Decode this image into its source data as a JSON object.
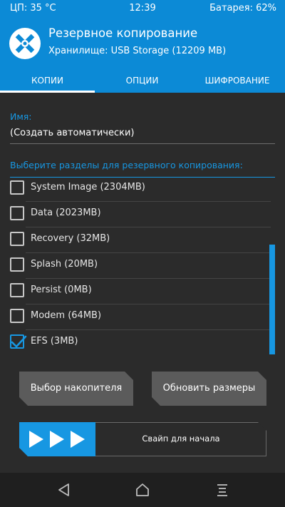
{
  "status": {
    "cpu": "ЦП: 35 °C",
    "time": "12:39",
    "battery": "Батарея: 62%"
  },
  "header": {
    "title": "Резервное копирование",
    "subtitle": "Хранилище: USB Storage (12209 MB)",
    "logo_icon": "twrp-logo-icon"
  },
  "tabs": [
    {
      "label": "КОПИИ",
      "active": true
    },
    {
      "label": "ОПЦИИ",
      "active": false
    },
    {
      "label": "ШИФРОВАНИЕ",
      "active": false
    }
  ],
  "name_field": {
    "label": "Имя:",
    "value": "(Создать автоматически)"
  },
  "partitions": {
    "label": "Выберите разделы для резервного копирования:",
    "items": [
      {
        "label": "System Image (2304MB)",
        "checked": false
      },
      {
        "label": "Data (2023MB)",
        "checked": false
      },
      {
        "label": "Recovery (32MB)",
        "checked": false
      },
      {
        "label": "Splash (20MB)",
        "checked": false
      },
      {
        "label": "Persist (0MB)",
        "checked": false
      },
      {
        "label": "Modem (64MB)",
        "checked": false
      },
      {
        "label": "EFS (3MB)",
        "checked": true
      }
    ]
  },
  "buttons": {
    "select_storage": "Выбор накопителя",
    "refresh_sizes": "Обновить размеры"
  },
  "swipe": {
    "label": "Свайп для начала",
    "icon": "triple-arrow-icon"
  },
  "colors": {
    "accent": "#1797e2",
    "header_bg": "#0c8ad6",
    "background": "#2b2b2b",
    "button_bg": "#5b5b5b",
    "navbar_bg": "#1f1f1f"
  },
  "navbar": {
    "icons": [
      "back-icon",
      "home-icon",
      "menu-icon"
    ]
  }
}
